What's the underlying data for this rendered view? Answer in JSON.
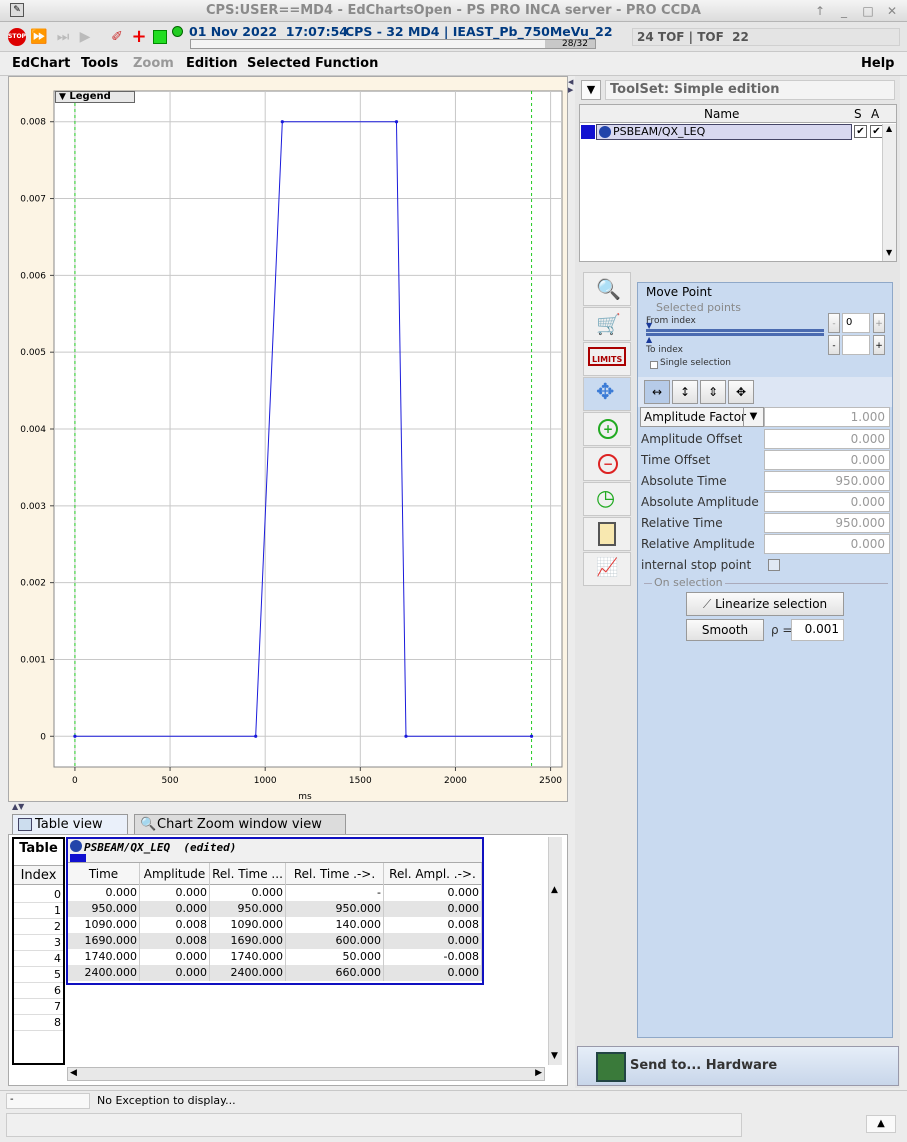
{
  "window": {
    "title": "CPS:USER==MD4 - EdChartsOpen - PS PRO INCA server - PRO CCDA"
  },
  "toolbar": {
    "datetime": "01 Nov 2022  17:07:54",
    "context": "CPS - 32 MD4 | IEAST_Pb_750MeVu_22",
    "counter": "28/32",
    "tof": "24 TOF | TOF  22"
  },
  "menu": {
    "edchart": "EdChart",
    "tools": "Tools",
    "zoom": "Zoom",
    "edition": "Edition",
    "selected_function": "Selected Function",
    "help": "Help"
  },
  "chart_data": {
    "type": "line",
    "x": [
      0,
      950,
      1090,
      1690,
      1740,
      2400
    ],
    "series": [
      {
        "name": "PSBEAM/QX_LEQ",
        "values": [
          0.0,
          0.0,
          0.008,
          0.008,
          0.0,
          0.0
        ]
      }
    ],
    "xlabel": "ms",
    "ylabel": "",
    "xlim": [
      -110,
      2560
    ],
    "ylim": [
      -0.0004,
      0.0084
    ],
    "x_ticks": [
      "0",
      "500",
      "1000",
      "1500",
      "2000",
      "2500"
    ],
    "y_ticks": [
      "0",
      "0.001",
      "0.002",
      "0.003",
      "0.004",
      "0.005",
      "0.006",
      "0.007",
      "0.008"
    ],
    "vlines": [
      0,
      2400
    ],
    "legend": "Legend",
    "grid": true
  },
  "tabs": {
    "table_view": "Table view",
    "chart_zoom": "Chart Zoom window view"
  },
  "table": {
    "corner_label": "Table",
    "index_header": "Index",
    "function_title": "PSBEAM/QX_LEQ  (edited)",
    "columns": [
      "Time",
      "Amplitude",
      "Rel. Time ...",
      "Rel. Time .->.",
      "Rel. Ampl. .->."
    ],
    "rows": [
      [
        "0.000",
        "0.000",
        "0.000",
        "-",
        "0.000"
      ],
      [
        "950.000",
        "0.000",
        "950.000",
        "950.000",
        "0.000"
      ],
      [
        "1090.000",
        "0.008",
        "1090.000",
        "140.000",
        "0.008"
      ],
      [
        "1690.000",
        "0.008",
        "1690.000",
        "600.000",
        "0.000"
      ],
      [
        "1740.000",
        "0.000",
        "1740.000",
        "50.000",
        "-0.008"
      ],
      [
        "2400.000",
        "0.000",
        "2400.000",
        "660.000",
        "0.000"
      ]
    ],
    "indices": [
      "0",
      "1",
      "2",
      "3",
      "4",
      "5",
      "6",
      "7",
      "8"
    ]
  },
  "toolset": {
    "title": "ToolSet: Simple edition",
    "name_header": "Name",
    "s_header": "S",
    "a_header": "A",
    "function_name": "PSBEAM/QX_LEQ"
  },
  "move_point": {
    "title": "Move Point",
    "selected_points": "Selected points",
    "from_index": "From index",
    "from_value": "0",
    "to_index": "To index",
    "to_value": "",
    "single_selection": "Single selection",
    "amplitude_factor_label": "Amplitude Factor",
    "amplitude_factor": "1.000",
    "amplitude_offset_label": "Amplitude Offset",
    "amplitude_offset": "0.000",
    "time_offset_label": "Time Offset",
    "time_offset": "0.000",
    "absolute_time_label": "Absolute Time",
    "absolute_time": "950.000",
    "absolute_amplitude_label": "Absolute Amplitude",
    "absolute_amplitude": "0.000",
    "relative_time_label": "Relative Time",
    "relative_time": "950.000",
    "relative_amplitude_label": "Relative Amplitude",
    "relative_amplitude": "0.000",
    "internal_stop_label": "internal stop point",
    "on_selection": "On selection",
    "linearize": "Linearize selection",
    "smooth": "Smooth",
    "rho_label": "ρ =",
    "rho_value": "0.001"
  },
  "send_hardware": "Send to... Hardware",
  "status": {
    "message": "No Exception to display...",
    "left": "-"
  },
  "colors": {
    "series": "#1a1adb",
    "vline": "#22cc22",
    "chart_bg": "#fcf4e4",
    "selection": "#0000cc",
    "panel_blue": "#c9daf0"
  }
}
